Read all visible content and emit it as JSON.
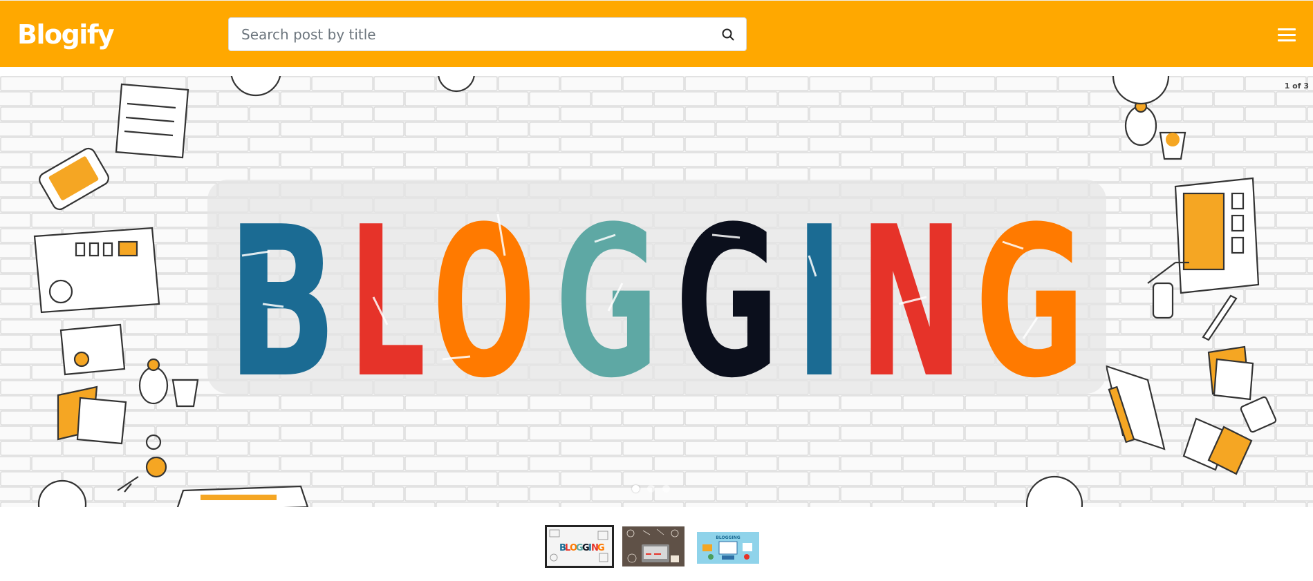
{
  "header": {
    "brand": "Blogify",
    "search": {
      "placeholder": "Search post by title",
      "value": ""
    },
    "search_icon": "search-icon",
    "menu_icon": "hamburger-menu-icon"
  },
  "carousel": {
    "counter": "1 of 3",
    "hero_word": "BLOGGING",
    "slides": [
      {
        "label": "BLOGGING",
        "active": true
      },
      {
        "label": "",
        "active": false
      },
      {
        "label": "BLOGGING",
        "active": false
      }
    ],
    "colors": {
      "brand": "#ffa800",
      "letter_blue": "#1b6b93",
      "letter_red": "#e63329",
      "letter_orange": "#ff7a00",
      "letter_teal": "#5ea8a4",
      "letter_dark": "#0b0f1c"
    }
  }
}
